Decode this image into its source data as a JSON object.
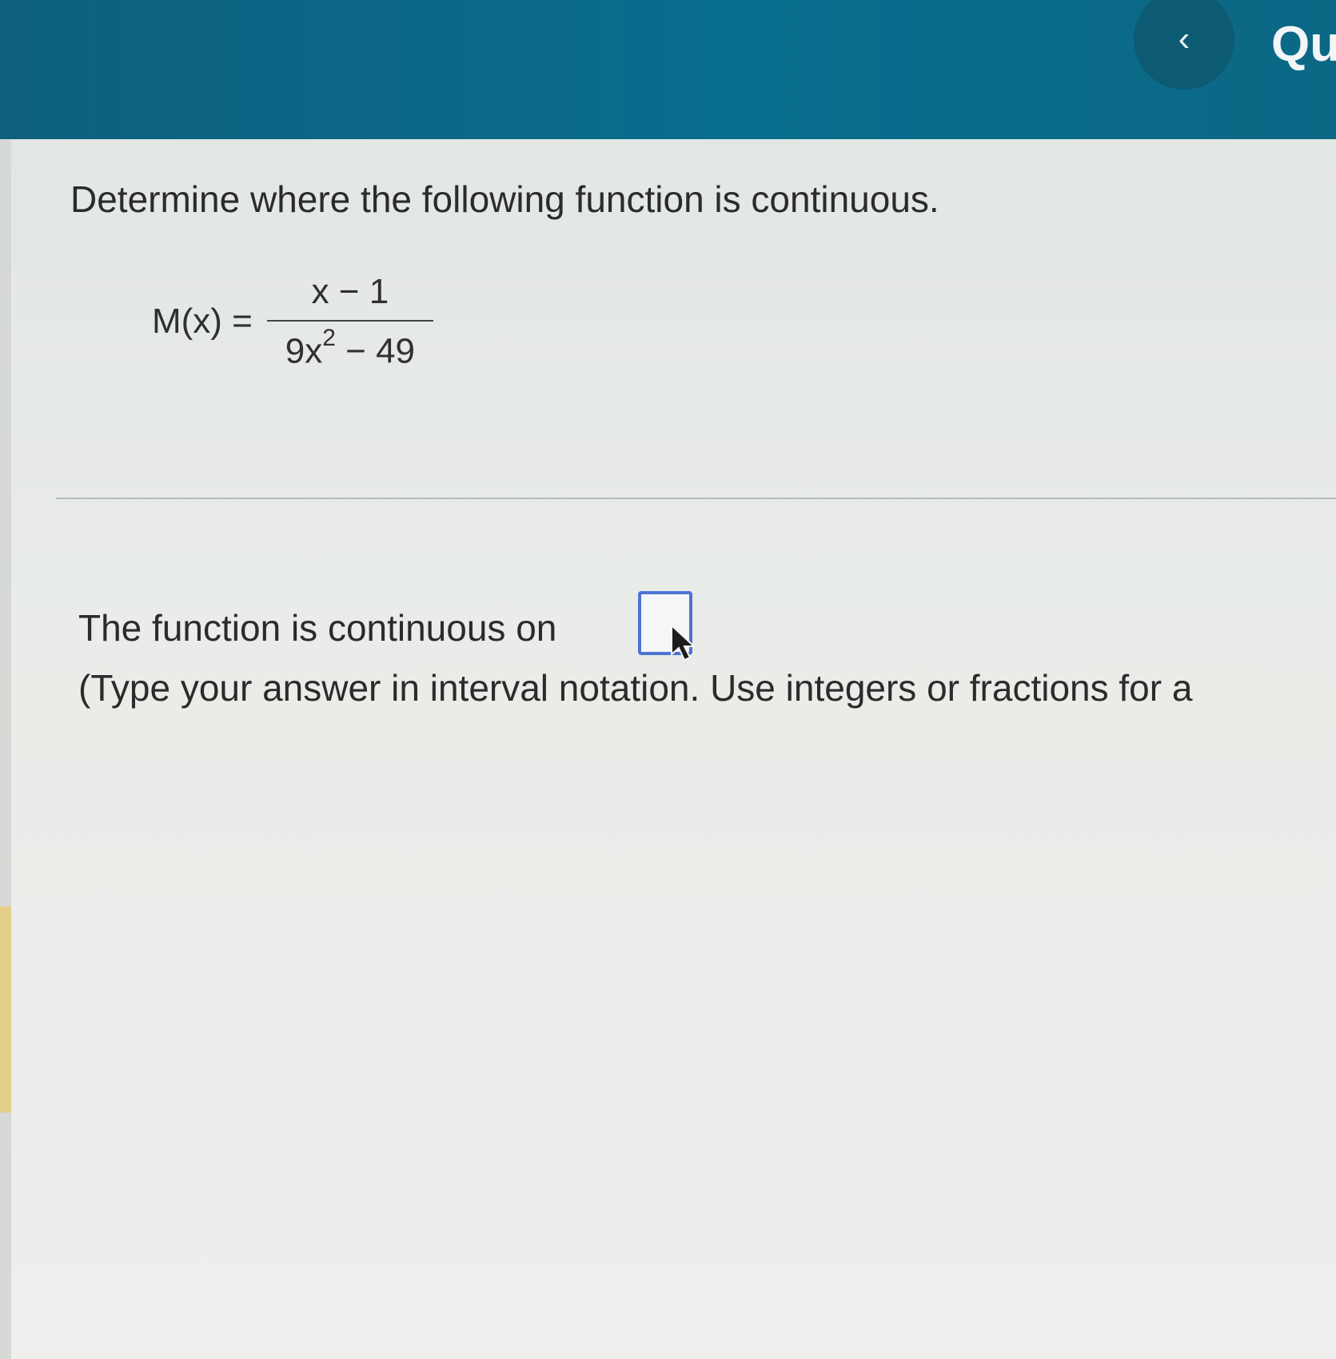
{
  "header": {
    "back_glyph": "‹",
    "title_partial": "Qu"
  },
  "question": {
    "prompt": "Determine where the following function is continuous.",
    "function_name": "M(x) =",
    "numerator": "x − 1",
    "denominator_base": "9x",
    "denominator_exponent": "2",
    "denominator_rest": " − 49"
  },
  "answer": {
    "lead_text": "The function is continuous on",
    "value": "",
    "hint": "(Type your answer in interval notation. Use integers or fractions for a"
  },
  "colors": {
    "header_bg": "#0a6e8e",
    "answer_box_border": "#4d73d4",
    "left_accent": "#e4cf8a"
  },
  "icons": {
    "back": "chevron-left-icon",
    "pointer": "mouse-pointer-icon"
  }
}
